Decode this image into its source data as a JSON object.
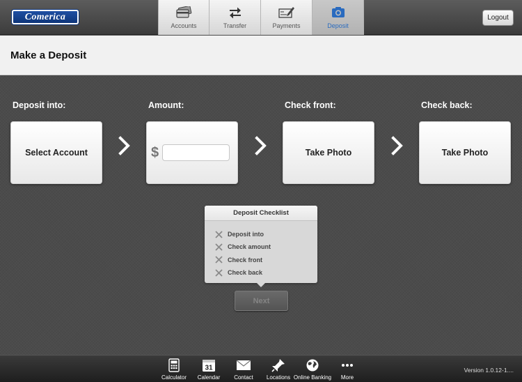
{
  "brand": {
    "logo_text": "Comerica",
    "logo_color": "#1e4fa3"
  },
  "header": {
    "tabs": [
      {
        "label": "Accounts",
        "icon": "credit-card-icon",
        "active": false
      },
      {
        "label": "Transfer",
        "icon": "transfer-arrows-icon",
        "active": false
      },
      {
        "label": "Payments",
        "icon": "check-pen-icon",
        "active": false
      },
      {
        "label": "Deposit",
        "icon": "camera-icon",
        "active": true
      }
    ],
    "logout_label": "Logout",
    "active_tab_color": "#2a6bbf"
  },
  "page": {
    "title": "Make a Deposit"
  },
  "steps": [
    {
      "label": "Deposit into:",
      "action": "Select Account"
    },
    {
      "label": "Amount:",
      "currency_symbol": "$",
      "value": "",
      "placeholder": ""
    },
    {
      "label": "Check front:",
      "action": "Take Photo"
    },
    {
      "label": "Check back:",
      "action": "Take Photo"
    }
  ],
  "checklist": {
    "title": "Deposit Checklist",
    "items": [
      {
        "label": "Deposit into",
        "icon": "x-mark-icon"
      },
      {
        "label": "Check amount",
        "icon": "x-mark-icon"
      },
      {
        "label": "Check front",
        "icon": "x-mark-icon"
      },
      {
        "label": "Check back",
        "icon": "x-mark-icon"
      }
    ]
  },
  "next_label": "Next",
  "toolbar": {
    "items": [
      {
        "label": "Calculator",
        "icon": "calculator-icon"
      },
      {
        "label": "Calendar",
        "icon": "calendar-icon",
        "day": "31"
      },
      {
        "label": "Contact",
        "icon": "envelope-icon"
      },
      {
        "label": "Locations",
        "icon": "map-pin-icon"
      },
      {
        "label": "Online Banking",
        "icon": "globe-icon"
      },
      {
        "label": "More",
        "icon": "more-dots-icon"
      }
    ],
    "version": "Version 1.0.12-1...."
  }
}
